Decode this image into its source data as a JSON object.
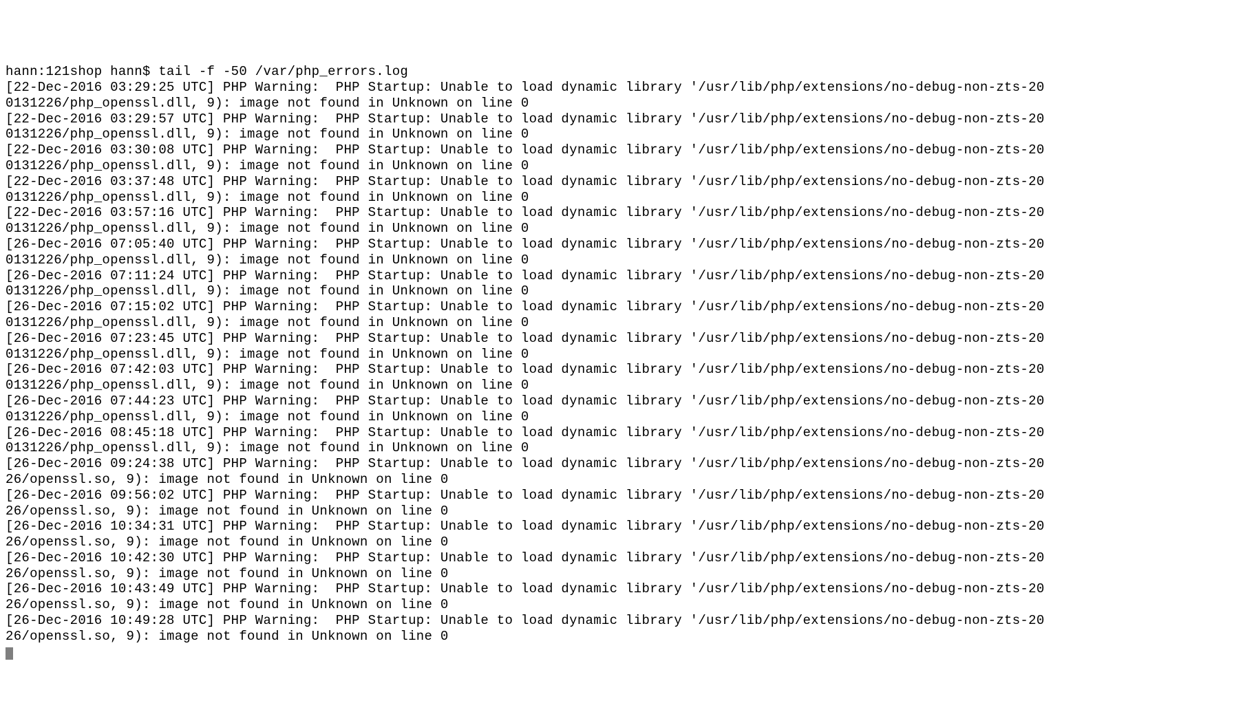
{
  "prompt": "hann:121shop hann$ tail -f -50 /var/php_errors.log",
  "log_path_prefix": "'/usr/lib/php/extensions/no-debug-non-zts-20",
  "warning_prefix": "PHP Warning:  PHP Startup: Unable to load dynamic library",
  "tail_dll": "0131226/php_openssl.dll, 9): image not found in Unknown on line 0",
  "tail_so": "26/openssl.so, 9): image not found in Unknown on line 0",
  "entries": [
    {
      "ts": "[22-Dec-2016 03:29:25 UTC]",
      "tail": "dll"
    },
    {
      "ts": "[22-Dec-2016 03:29:57 UTC]",
      "tail": "dll"
    },
    {
      "ts": "[22-Dec-2016 03:30:08 UTC]",
      "tail": "dll"
    },
    {
      "ts": "[22-Dec-2016 03:37:48 UTC]",
      "tail": "dll"
    },
    {
      "ts": "[22-Dec-2016 03:57:16 UTC]",
      "tail": "dll"
    },
    {
      "ts": "[26-Dec-2016 07:05:40 UTC]",
      "tail": "dll"
    },
    {
      "ts": "[26-Dec-2016 07:11:24 UTC]",
      "tail": "dll"
    },
    {
      "ts": "[26-Dec-2016 07:15:02 UTC]",
      "tail": "dll"
    },
    {
      "ts": "[26-Dec-2016 07:23:45 UTC]",
      "tail": "dll"
    },
    {
      "ts": "[26-Dec-2016 07:42:03 UTC]",
      "tail": "dll"
    },
    {
      "ts": "[26-Dec-2016 07:44:23 UTC]",
      "tail": "dll"
    },
    {
      "ts": "[26-Dec-2016 08:45:18 UTC]",
      "tail": "dll"
    },
    {
      "ts": "[26-Dec-2016 09:24:38 UTC]",
      "tail": "so"
    },
    {
      "ts": "[26-Dec-2016 09:56:02 UTC]",
      "tail": "so"
    },
    {
      "ts": "[26-Dec-2016 10:34:31 UTC]",
      "tail": "so"
    },
    {
      "ts": "[26-Dec-2016 10:42:30 UTC]",
      "tail": "so"
    },
    {
      "ts": "[26-Dec-2016 10:43:49 UTC]",
      "tail": "so"
    },
    {
      "ts": "[26-Dec-2016 10:49:28 UTC]",
      "tail": "so"
    }
  ]
}
